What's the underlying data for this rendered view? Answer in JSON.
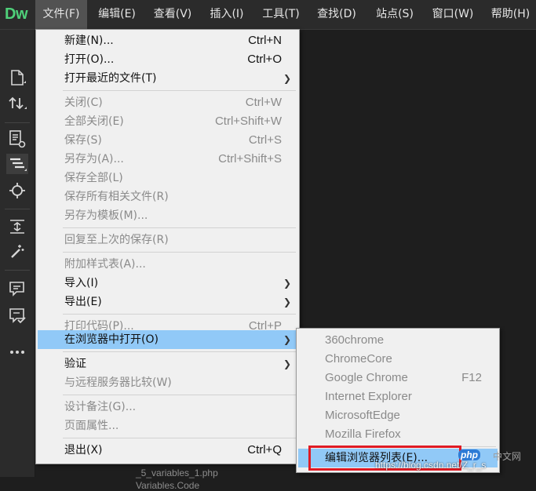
{
  "app": {
    "logo": "Dw"
  },
  "menubar": {
    "items": [
      {
        "label": "文件(F)",
        "active": true
      },
      {
        "label": "编辑(E)"
      },
      {
        "label": "查看(V)"
      },
      {
        "label": "插入(I)"
      },
      {
        "label": "工具(T)"
      },
      {
        "label": "查找(D)"
      },
      {
        "label": "站点(S)"
      },
      {
        "label": "窗口(W)"
      },
      {
        "label": "帮助(H)"
      }
    ]
  },
  "toolbar": {
    "icons": [
      "new-file-icon",
      "sort-arrows-icon",
      "document-view-icon",
      "structure-icon",
      "target-icon",
      "expand-icon",
      "wand-icon",
      "comment-icon",
      "note-check-icon",
      "more-icon"
    ]
  },
  "background": {
    "file1": "_5_variables_1.php",
    "file2": "Variables.Code"
  },
  "file_menu": {
    "new": {
      "label": "新建(N)...",
      "shortcut": "Ctrl+N"
    },
    "open": {
      "label": "打开(O)...",
      "shortcut": "Ctrl+O"
    },
    "recent": {
      "label": "打开最近的文件(T)"
    },
    "close": {
      "label": "关闭(C)",
      "shortcut": "Ctrl+W"
    },
    "close_all": {
      "label": "全部关闭(E)",
      "shortcut": "Ctrl+Shift+W"
    },
    "save": {
      "label": "保存(S)",
      "shortcut": "Ctrl+S"
    },
    "save_as": {
      "label": "另存为(A)...",
      "shortcut": "Ctrl+Shift+S"
    },
    "save_all": {
      "label": "保存全部(L)"
    },
    "save_related": {
      "label": "保存所有相关文件(R)"
    },
    "save_template": {
      "label": "另存为模板(M)..."
    },
    "revert": {
      "label": "回复至上次的保存(R)"
    },
    "attach_css": {
      "label": "附加样式表(A)..."
    },
    "import": {
      "label": "导入(I)"
    },
    "export": {
      "label": "导出(E)"
    },
    "print": {
      "label": "打印代码(P)...",
      "shortcut": "Ctrl+P"
    },
    "open_browser": {
      "label": "在浏览器中打开(O)"
    },
    "validate": {
      "label": "验证"
    },
    "compare": {
      "label": "与远程服务器比较(W)"
    },
    "design_notes": {
      "label": "设计备注(G)..."
    },
    "page_props": {
      "label": "页面属性..."
    },
    "exit": {
      "label": "退出(X)",
      "shortcut": "Ctrl+Q"
    }
  },
  "browser_menu": {
    "items": [
      {
        "label": "360chrome",
        "shortcut": ""
      },
      {
        "label": "ChromeCore",
        "shortcut": ""
      },
      {
        "label": "Google Chrome",
        "shortcut": "F12"
      },
      {
        "label": "Internet Explorer",
        "shortcut": ""
      },
      {
        "label": "MicrosoftEdge",
        "shortcut": ""
      },
      {
        "label": "Mozilla Firefox",
        "shortcut": ""
      }
    ],
    "edit_list": {
      "label": "编辑浏览器列表(E)..."
    }
  },
  "watermark": {
    "php": "php",
    "cn": "中文网",
    "url": "https://blog.csdn.net/Z_r_s"
  },
  "colors": {
    "highlight": "#91c9f7",
    "annotation_box": "#e01b24",
    "logo_green": "#4fd17a"
  }
}
